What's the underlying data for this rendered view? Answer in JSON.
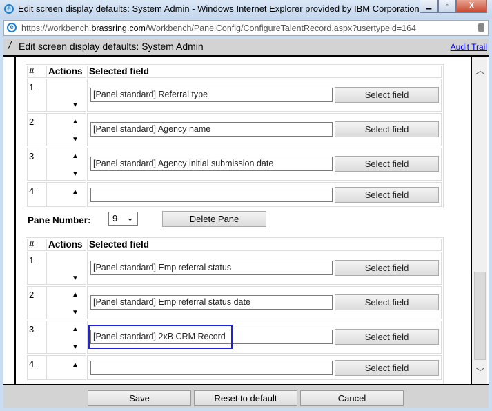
{
  "window": {
    "title": "Edit screen display defaults: System Admin - Windows Internet Explorer provided by IBM Corporation",
    "url_prefix": "https://workbench.",
    "url_domain": "brassring.com",
    "url_path": "/Workbench/PanelConfig/ConfigureTalentRecord.aspx?usertypeid=164"
  },
  "dialog": {
    "title": "Edit screen display defaults: System Admin",
    "audit_trail": "Audit Trail"
  },
  "table_headers": {
    "num": "#",
    "actions": "Actions",
    "field": "Selected field"
  },
  "select_label": "Select field",
  "pane_a": {
    "rows": [
      {
        "num": "1",
        "value": "[Panel standard] Referral type",
        "up": false,
        "down": true
      },
      {
        "num": "2",
        "value": "[Panel standard] Agency name",
        "up": true,
        "down": true
      },
      {
        "num": "3",
        "value": "[Panel standard] Agency initial submission date",
        "up": true,
        "down": true
      },
      {
        "num": "4",
        "value": "",
        "up": true,
        "down": false
      }
    ]
  },
  "pane_control": {
    "label": "Pane Number:",
    "selected": "9",
    "delete_label": "Delete Pane"
  },
  "pane_b": {
    "rows": [
      {
        "num": "1",
        "value": "[Panel standard] Emp referral status",
        "up": false,
        "down": true
      },
      {
        "num": "2",
        "value": "[Panel standard] Emp referral status date",
        "up": true,
        "down": true
      },
      {
        "num": "3",
        "value": "[Panel standard] 2xB CRM Record",
        "up": true,
        "down": true,
        "highlighted": true
      },
      {
        "num": "4",
        "value": "",
        "up": true,
        "down": false
      }
    ]
  },
  "footer": {
    "save": "Save",
    "reset": "Reset to default",
    "cancel": "Cancel"
  },
  "colors": {
    "highlight": "#2222dd",
    "link": "#0000ee"
  }
}
